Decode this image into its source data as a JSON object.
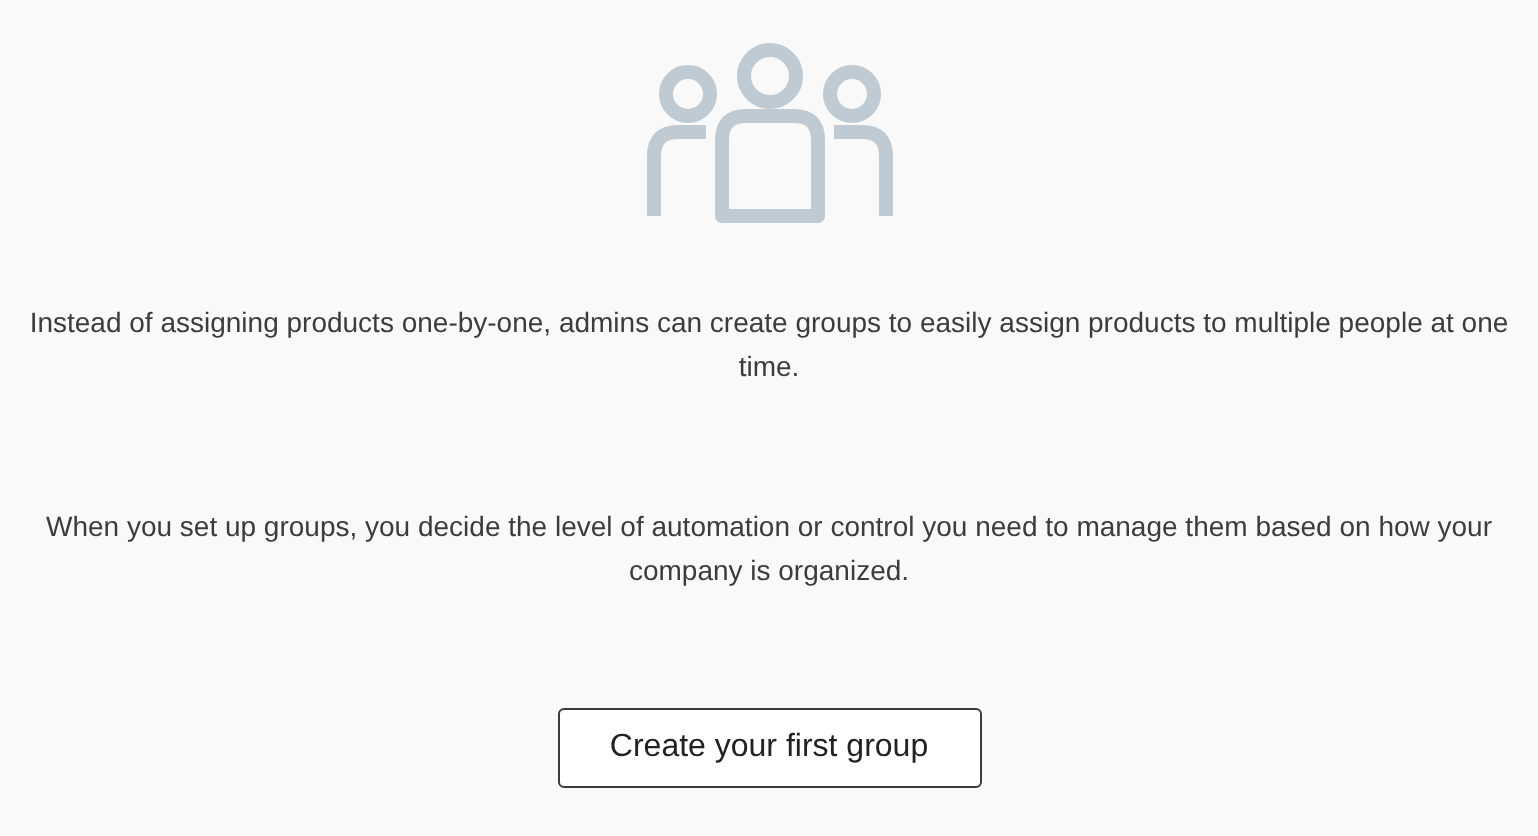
{
  "paragraphs": [
    "Instead of assigning products one-by-one, admins can create groups to easily assign products to multiple people at one time.",
    "When you set up groups, you decide the level of automation or control you need to manage them based on how your company is organized."
  ],
  "button": {
    "label": "Create your first group"
  }
}
